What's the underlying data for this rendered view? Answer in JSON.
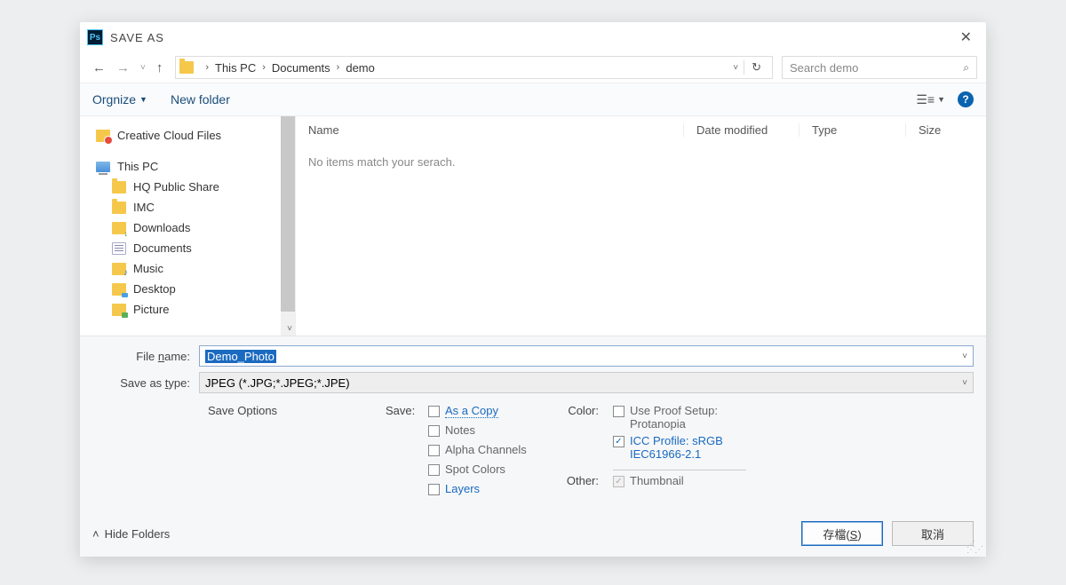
{
  "title": "SAVE AS",
  "breadcrumb": {
    "root": "This PC",
    "p1": "Documents",
    "p2": "demo"
  },
  "search": {
    "placeholder": "Search demo"
  },
  "toolbar": {
    "organize": "Orgnize",
    "newfolder": "New folder"
  },
  "columns": {
    "name": "Name",
    "date": "Date modified",
    "type": "Type",
    "size": "Size"
  },
  "empty": "No items match your serach.",
  "tree": {
    "cloud": "Creative Cloud Files",
    "thispc": "This PC",
    "hq": "HQ Public Share",
    "imc": "IMC",
    "downloads": "Downloads",
    "documents": "Documents",
    "music": "Music",
    "desktop": "Desktop",
    "picture": "Picture"
  },
  "fields": {
    "filename_label_pre": "File ",
    "filename_label_ul": "n",
    "filename_label_post": "ame:",
    "filename_value": "Demo_Photo",
    "type_label_pre": "Save as ",
    "type_label_ul": "t",
    "type_label_post": "ype:",
    "type_value": "JPEG (*.JPG;*.JPEG;*.JPE)"
  },
  "opts": {
    "header": "Save Options",
    "save_label": "Save:",
    "as_copy": "As a Copy",
    "notes": "Notes",
    "alpha": "Alpha Channels",
    "spot": "Spot Colors",
    "layers": "Layers",
    "color_label": "Color:",
    "proof": "Use Proof Setup: Protanopia",
    "icc": "ICC Profile:  sRGB IEC61966-2.1",
    "other_label": "Other:",
    "thumb": "Thumbnail"
  },
  "footer": {
    "hide": "Hide Folders",
    "save_pre": "存檔(",
    "save_ul": "S",
    "save_post": ")",
    "cancel": "取消"
  }
}
